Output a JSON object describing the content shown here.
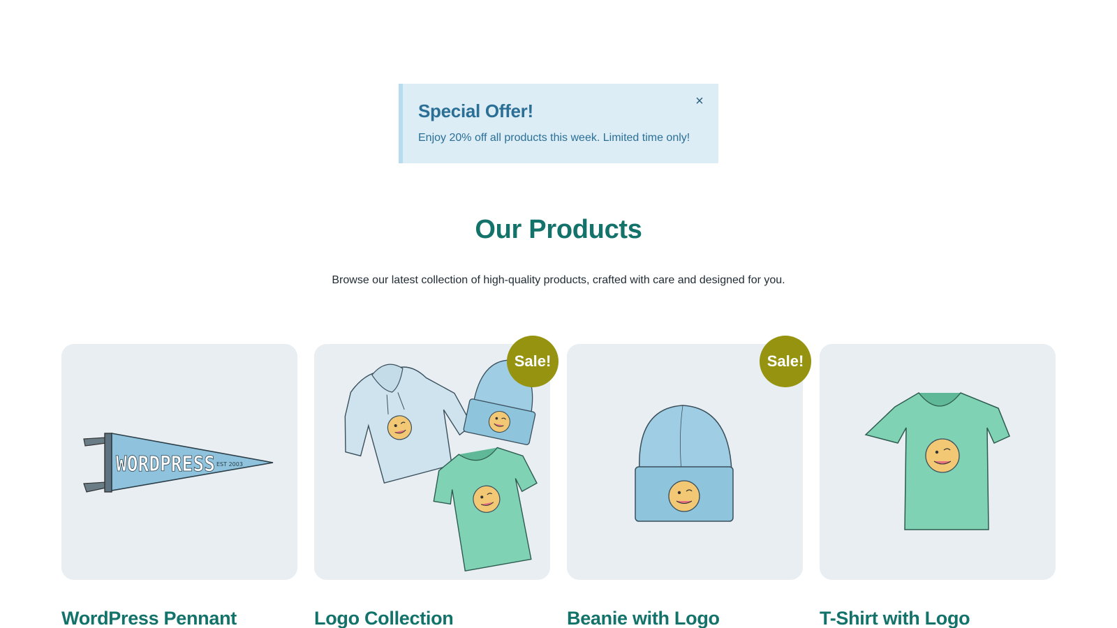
{
  "notice": {
    "title": "Special Offer!",
    "text": "Enjoy 20% off all products this week. Limited time only!",
    "close_symbol": "×",
    "close_icon": "close-icon"
  },
  "section": {
    "title": "Our Products",
    "subtitle": "Browse our latest collection of high-quality products, crafted with care and designed for you."
  },
  "products": [
    {
      "name": "WordPress Pennant",
      "on_sale": false,
      "image": "pennant",
      "pennant_text": "WORDPRESS",
      "pennant_small_text": "EST 2003"
    },
    {
      "name": "Logo Collection",
      "on_sale": true,
      "badge": "Sale!",
      "image": "logo-collection"
    },
    {
      "name": "Beanie with Logo",
      "on_sale": true,
      "badge": "Sale!",
      "image": "beanie"
    },
    {
      "name": "T-Shirt with Logo",
      "on_sale": false,
      "image": "tshirt"
    }
  ],
  "colors": {
    "accent": "#13736a",
    "notice_bg": "#dcedf6",
    "notice_text": "#2b6f96",
    "sale_badge": "#95930f",
    "card_bg": "#e8eef2"
  }
}
